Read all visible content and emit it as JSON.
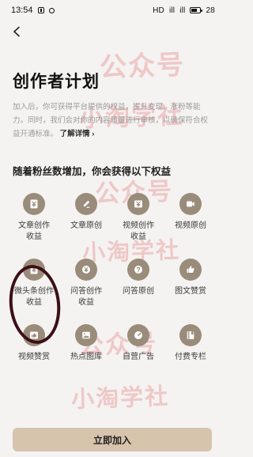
{
  "status_bar": {
    "time": "13:54",
    "network": "HD",
    "signal_1": "ill",
    "signal_2": "ill",
    "battery": "28"
  },
  "page": {
    "title": "创作者计划",
    "intro_text": "加入后，你可获得平台提供的权益，提升变现、涨粉等能力。同时，我们会对你的内容质量进行审核，以确保符合权益开通标准。",
    "intro_link": "了解详情 ›",
    "section_title": "随着粉丝数增加，你会获得以下权益",
    "primary_button": "立即加入"
  },
  "benefits": [
    {
      "label": "文章创作\n收益",
      "icon": "yen-card-icon"
    },
    {
      "label": "文章原创",
      "icon": "pen-edit-icon"
    },
    {
      "label": "视频创作\n收益",
      "icon": "yen-video-icon"
    },
    {
      "label": "视频原创",
      "icon": "video-camera-icon"
    },
    {
      "label": "微头条创作\n收益",
      "icon": "yen-card-icon"
    },
    {
      "label": "问答创作\n收益",
      "icon": "yen-circle-icon"
    },
    {
      "label": "问答原创",
      "icon": "question-icon"
    },
    {
      "label": "图文赞赏",
      "icon": "thumbs-up-icon"
    },
    {
      "label": "视频赞赏",
      "icon": "thumbs-up-video-icon"
    },
    {
      "label": "热点图库",
      "icon": "image-icon"
    },
    {
      "label": "自营广告",
      "icon": "gauge-icon"
    },
    {
      "label": "付费专栏",
      "icon": "book-icon"
    }
  ],
  "watermarks": [
    "公众号",
    "小淘学社"
  ],
  "colors": {
    "icon_background": "#9a8c7a",
    "button_background": "#d7c4ad",
    "annotation_ring": "#3d0f16",
    "watermark": "#e27878"
  }
}
